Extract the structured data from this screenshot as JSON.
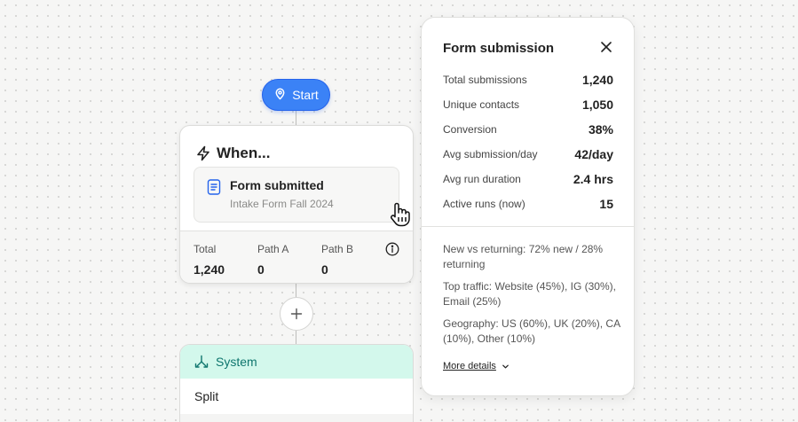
{
  "flow": {
    "start_label": "Start",
    "when_card": {
      "title": "When...",
      "trigger": {
        "title": "Form submitted",
        "subtitle": "Intake Form Fall 2024"
      },
      "stats": [
        {
          "label": "Total",
          "value": "1,240"
        },
        {
          "label": "Path A",
          "value": "0"
        },
        {
          "label": "Path B",
          "value": "0"
        }
      ]
    },
    "system_card": {
      "title": "System",
      "row_label": "Split"
    }
  },
  "panel": {
    "title": "Form submission",
    "metrics": [
      {
        "label": "Total submissions",
        "value": "1,240"
      },
      {
        "label": "Unique contacts",
        "value": "1,050"
      },
      {
        "label": "Conversion",
        "value": "38%"
      },
      {
        "label": "Avg submission/day",
        "value": "42/day"
      },
      {
        "label": "Avg run duration",
        "value": "2.4 hrs"
      },
      {
        "label": "Active runs (now)",
        "value": "15"
      }
    ],
    "insights": [
      "New vs returning: 72% new / 28% returning",
      "Top traffic: Website (45%), IG (30%), Email (25%)",
      "Geography: US (60%), UK (20%), CA (10%), Other (10%)"
    ],
    "more_details_label": "More details"
  },
  "colors": {
    "accent_blue": "#3b82f6",
    "system_header_bg": "#d3f8ec",
    "system_header_text": "#0f766e"
  },
  "icons": [
    "map-pin-icon",
    "lightning-icon",
    "document-icon",
    "hand-pointer-icon",
    "info-icon",
    "plus-icon",
    "split-icon",
    "close-icon",
    "chevron-down-icon"
  ]
}
